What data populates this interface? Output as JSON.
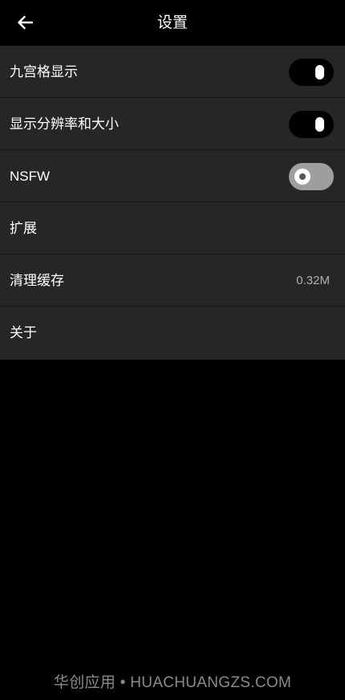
{
  "header": {
    "title": "设置",
    "back_icon": "arrow-left-icon"
  },
  "settings": {
    "grid_display": {
      "label": "九宫格显示",
      "toggle_on": true
    },
    "show_resolution": {
      "label": "显示分辨率和大小",
      "toggle_on": true
    },
    "nsfw": {
      "label": "NSFW",
      "toggle_on": false
    },
    "extensions": {
      "label": "扩展"
    },
    "clear_cache": {
      "label": "清理缓存",
      "value": "0.32M"
    },
    "about": {
      "label": "关于"
    }
  },
  "watermark": {
    "text": "华创应用 • HUACHUANGZS.COM"
  },
  "colors": {
    "background": "#000000",
    "list_background": "#262626",
    "toggle_on_track": "#000000",
    "toggle_off_track": "#9e9e9e"
  }
}
